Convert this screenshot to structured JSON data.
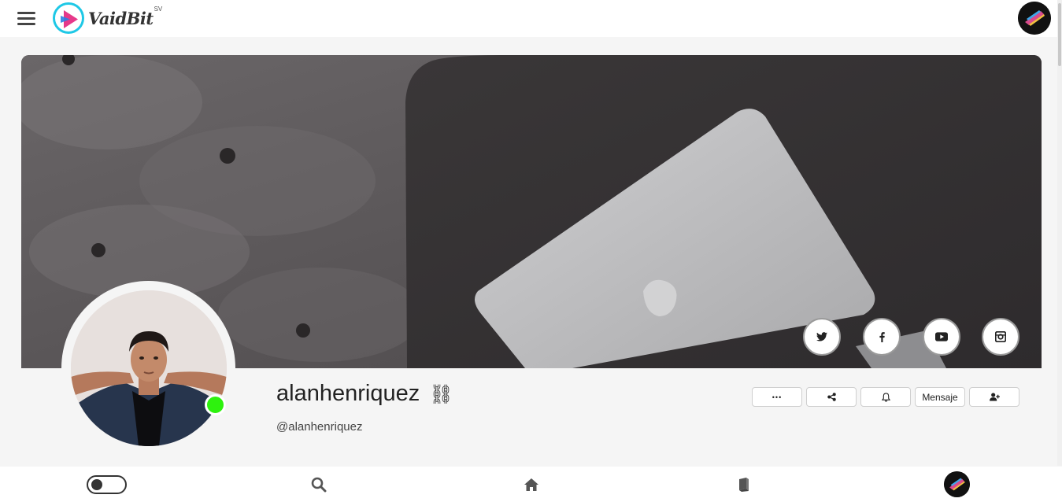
{
  "header": {
    "logo_text": "VaidBit",
    "logo_suffix": "SV",
    "logo_mark_text": "VIDEO"
  },
  "profile": {
    "username": "alanhenriquez",
    "username_emoji": "⛓",
    "handle": "@alanhenriquez",
    "online": true
  },
  "social": [
    {
      "name": "twitter",
      "icon": "twitter-icon"
    },
    {
      "name": "facebook",
      "icon": "facebook-icon"
    },
    {
      "name": "youtube",
      "icon": "youtube-icon"
    },
    {
      "name": "instagram",
      "icon": "instagram-icon"
    }
  ],
  "actions": {
    "more": "•••",
    "share_icon": "share-icon",
    "bell_icon": "bell-icon",
    "message_label": "Mensaje",
    "follow_icon": "add-user-icon"
  },
  "bottom_nav": [
    {
      "name": "theme-toggle",
      "icon": "toggle-icon"
    },
    {
      "name": "search",
      "icon": "search-icon"
    },
    {
      "name": "home",
      "icon": "home-icon"
    },
    {
      "name": "library",
      "icon": "book-icon"
    },
    {
      "name": "profile",
      "icon": "avatar"
    }
  ],
  "colors": {
    "accent": "#1ec8e6",
    "logo_play": "#e6398a",
    "online": "#2ef20e",
    "cover": "#3c393b"
  }
}
